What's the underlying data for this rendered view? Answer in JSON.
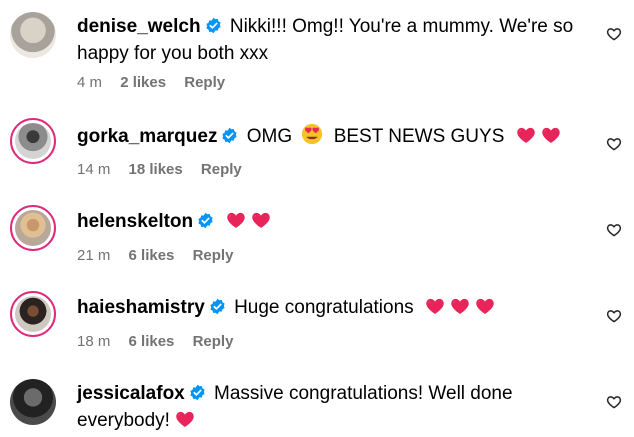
{
  "comments": [
    {
      "username": "denise_welch",
      "text": "Nikki!!! Omg!! You're a mummy. We're so happy for you both xxx",
      "time": "4 m",
      "likes": "2 likes",
      "reply": "Reply"
    },
    {
      "username": "gorka_marquez",
      "text_before": "OMG",
      "text_after": "BEST NEWS GUYS",
      "time": "14 m",
      "likes": "18 likes",
      "reply": "Reply"
    },
    {
      "username": "helenskelton",
      "time": "21 m",
      "likes": "6 likes",
      "reply": "Reply"
    },
    {
      "username": "haieshamistry",
      "text": "Huge congratulations",
      "time": "18 m",
      "likes": "6 likes",
      "reply": "Reply"
    },
    {
      "username": "jessicalafox",
      "text": "Massive congratulations! Well done everybody!"
    }
  ],
  "colors": {
    "verified_blue": "#0095f6",
    "heart_red": "#e8255a",
    "meta_gray": "#737373",
    "story_ring": "#dd2a7b"
  },
  "icons": {
    "verified": "verified-badge-icon",
    "like": "heart-outline-icon",
    "emoji_heart": "red-heart-emoji",
    "emoji_eyes": "heart-eyes-emoji"
  }
}
